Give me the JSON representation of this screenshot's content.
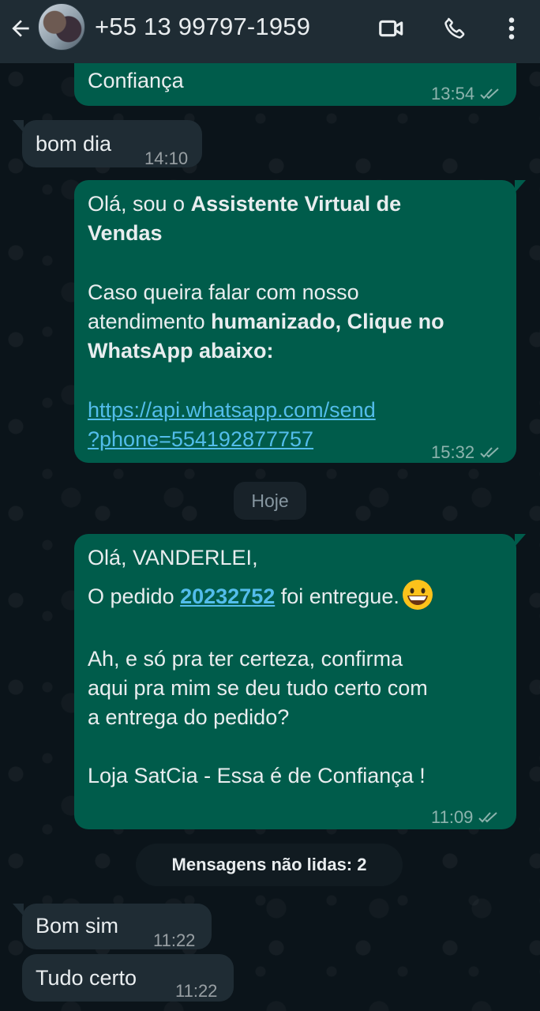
{
  "header": {
    "contact": "+55 13 99797-1959"
  },
  "messages": {
    "m1": {
      "text": "Confiança",
      "time": "13:54"
    },
    "m2": {
      "text": "bom dia",
      "time": "14:10"
    },
    "m3": {
      "l1a": "Olá, sou o ",
      "l1b": "Assistente Virtual de",
      "l2": "Vendas",
      "l3": "Caso queira falar com nosso",
      "l4a": "atendimento ",
      "l4b": "humanizado, Clique no",
      "l5": "WhatsApp abaixo:",
      "link1": "https://api.whatsapp.com/send",
      "link2": "?phone=554192877757",
      "time": "15:32"
    },
    "date_pill": "Hoje",
    "m4": {
      "l1": "Olá, VANDERLEI,",
      "l2a": "O pedido ",
      "order": "20232752",
      "l2b": " foi entregue.",
      "l3": "Ah, e só pra ter certeza, confirma",
      "l4": "aqui pra mim se deu tudo certo com",
      "l5": "a entrega do pedido?",
      "l6": "Loja SatCia - Essa é de Confiança !",
      "time": "11:09"
    },
    "unread": "Mensagens não lidas: 2",
    "m5": {
      "text": "Bom sim",
      "time": "11:22"
    },
    "m6": {
      "text": "Tudo certo",
      "time": "11:22"
    }
  },
  "icons": [
    "back-arrow-icon",
    "avatar",
    "video-call-icon",
    "phone-icon",
    "more-options-icon",
    "double-check-icon",
    "grinning-face-emoji"
  ],
  "colors": {
    "outgoing": "#005c4b",
    "incoming": "#1f2c34",
    "header": "#1f2c34",
    "link": "#53bdeb"
  }
}
